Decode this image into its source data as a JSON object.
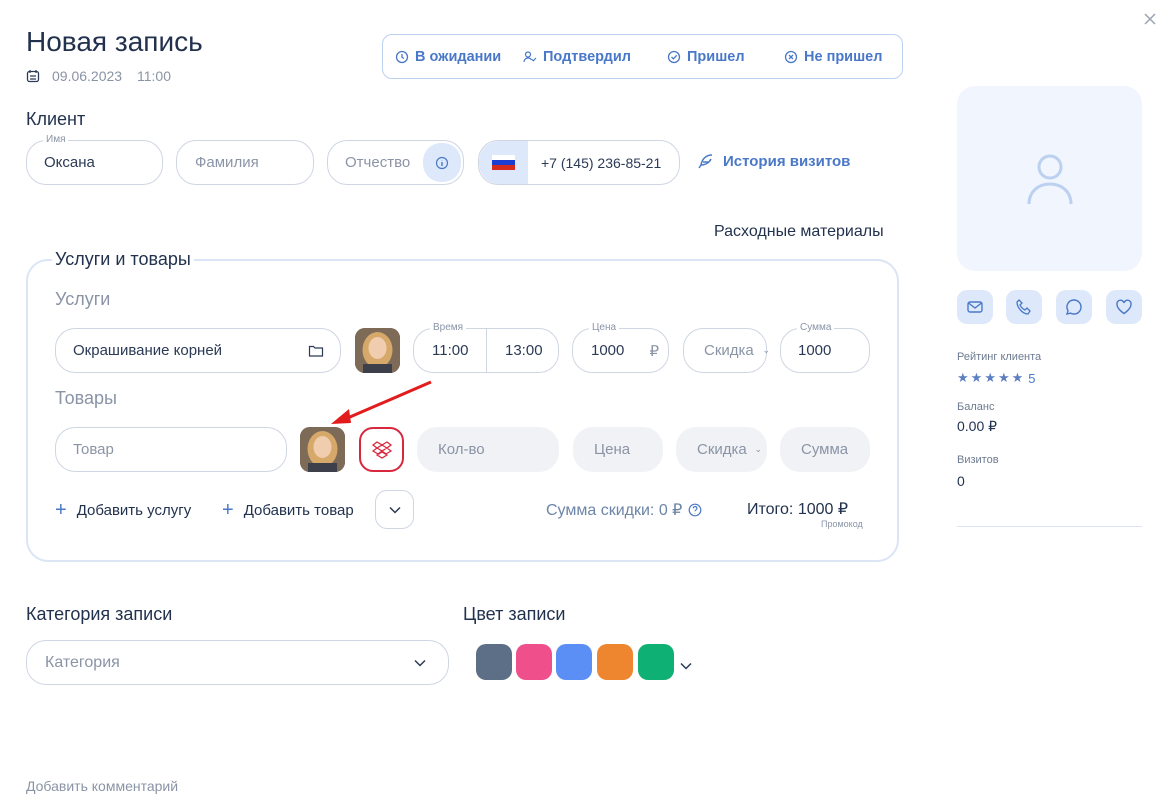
{
  "header": {
    "title": "Новая запись",
    "date": "09.06.2023",
    "time": "11:00"
  },
  "statuses": [
    {
      "label": "В ожидании",
      "icon": "clock-icon"
    },
    {
      "label": "Подтвердил",
      "icon": "user-check-icon"
    },
    {
      "label": "Пришел",
      "icon": "check-circle-icon"
    },
    {
      "label": "Не пришел",
      "icon": "x-circle-icon"
    }
  ],
  "client": {
    "section_title": "Клиент",
    "name_label": "Имя",
    "name_value": "Оксана",
    "surname_placeholder": "Фамилия",
    "patronymic_placeholder": "Отчество",
    "phone": "+7 (145) 236-85-21",
    "history_link": "История визитов"
  },
  "consumables_link": "Расходные материалы",
  "services_goods": {
    "section_title": "Услуги и товары",
    "services_title": "Услуги",
    "service_name": "Окрашивание корней",
    "time_label": "Время",
    "time_start": "11:00",
    "time_end": "13:00",
    "price_label": "Цена",
    "price_value": "1000",
    "currency": "₽",
    "discount_placeholder": "Скидка",
    "sum_label": "Сумма",
    "sum_value": "1000",
    "goods_title": "Товары",
    "goods_placeholder": "Товар",
    "qty_placeholder": "Кол-во",
    "goods_price_placeholder": "Цена",
    "goods_discount_placeholder": "Скидка",
    "goods_sum_placeholder": "Сумма",
    "add_service": "Добавить услугу",
    "add_goods": "Добавить товар",
    "discount_sum": "Сумма скидки: 0 ₽",
    "total": "Итого: 1000 ₽",
    "promo": "Промокод"
  },
  "category": {
    "title": "Категория записи",
    "placeholder": "Категория"
  },
  "color": {
    "title": "Цвет записи",
    "swatches": [
      "#5d6f87",
      "#ef4f8b",
      "#5b8ff5",
      "#ee8630",
      "#0fb073"
    ]
  },
  "comment_link": "Добавить комментарий",
  "sidebar": {
    "rating_label": "Рейтинг клиента",
    "rating_value": "5",
    "balance_label": "Баланс",
    "balance_value": "0.00 ₽",
    "visits_label": "Визитов",
    "visits_value": "0"
  },
  "colors": {
    "accent": "#4a78c8",
    "light_accent": "#dde8fb",
    "danger": "#d8283e"
  }
}
